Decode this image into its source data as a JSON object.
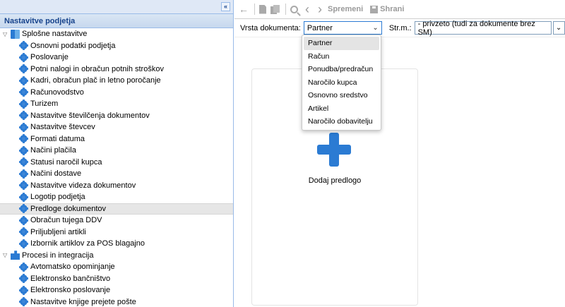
{
  "left_panel": {
    "collapse_glyph": "«",
    "title": "Nastavitve podjetja",
    "groups": [
      {
        "label": "Splošne nastavitve",
        "icon": "book-icon",
        "items": [
          {
            "label": "Osnovni podatki podjetja"
          },
          {
            "label": "Poslovanje"
          },
          {
            "label": "Potni nalogi in obračun potnih stroškov"
          },
          {
            "label": "Kadri, obračun plač in letno poročanje"
          },
          {
            "label": "Računovodstvo"
          },
          {
            "label": "Turizem"
          },
          {
            "label": "Nastavitve številčenja dokumentov"
          },
          {
            "label": "Nastavitve števcev"
          },
          {
            "label": "Formati datuma"
          },
          {
            "label": "Načini plačila"
          },
          {
            "label": "Statusi naročil kupca"
          },
          {
            "label": "Načini dostave"
          },
          {
            "label": "Nastavitve videza dokumentov"
          },
          {
            "label": "Logotip podjetja"
          },
          {
            "label": "Predloge dokumentov",
            "selected": true
          },
          {
            "label": "Obračun tujega DDV"
          },
          {
            "label": "Priljubljeni artikli"
          },
          {
            "label": "Izbornik artiklov za POS blagajno"
          }
        ]
      },
      {
        "label": "Procesi in integracija",
        "icon": "puzzle-icon",
        "items": [
          {
            "label": "Avtomatsko opominjanje"
          },
          {
            "label": "Elektronsko bančništvo"
          },
          {
            "label": "Elektronsko poslovanje"
          },
          {
            "label": "Nastavitve knjige prejete pošte"
          }
        ]
      }
    ]
  },
  "toolbar": {
    "back_glyph": "←",
    "prev_glyph": "‹",
    "next_glyph": "›",
    "spremeni_label": "Spremeni",
    "shrani_label": "Shrani"
  },
  "filters": {
    "vrsta_label": "Vrsta dokumenta:",
    "vrsta_value": "Partner",
    "stm_label": "Str.m.:",
    "stm_value": "- privzeto (tudi za dokumente brez SM)"
  },
  "dropdown": {
    "options": [
      "Partner",
      "Račun",
      "Ponudba/predračun",
      "Naročilo kupca",
      "Osnovno sredstvo",
      "Artikel",
      "Naročilo dobavitelju"
    ],
    "selected_index": 0
  },
  "canvas": {
    "add_label": "Dodaj predlogo"
  },
  "colors": {
    "accent": "#2b7bd3",
    "panel_header": "#c7d8ee",
    "panel_text": "#15428b",
    "selected_row": "#e6e6e6"
  }
}
